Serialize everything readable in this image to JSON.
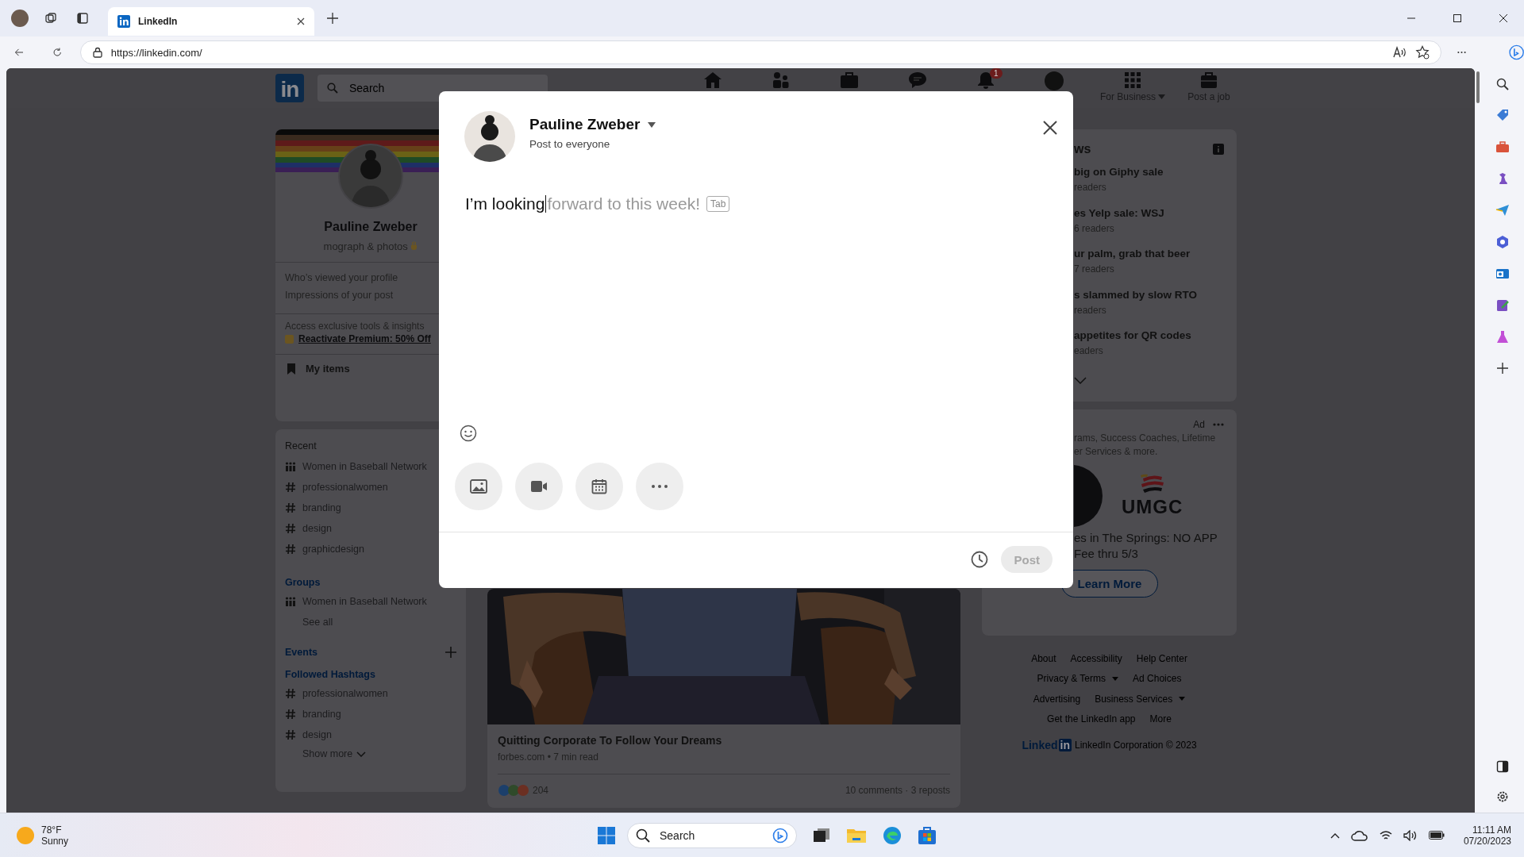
{
  "browser": {
    "tabs": [
      {
        "title": "LinkedIn",
        "selected": true
      }
    ],
    "url": "https://linkedin.com/"
  },
  "nav": {
    "logo": "in",
    "search_placeholder": "Search",
    "notification_count": "1",
    "labels": [
      "For Business",
      "Post a job"
    ]
  },
  "profile": {
    "name": "Pauline Zweber",
    "headline": "mograph & photos",
    "stats": [
      "Who’s viewed your profile",
      "Impressions of your post"
    ],
    "premium_note": "Access exclusive tools & insights",
    "premium_link": "Reactivate Premium: 50% Off",
    "my_items": "My items"
  },
  "recent": {
    "title": "Recent",
    "items": [
      {
        "kind": "group",
        "label": "Women in Baseball Network"
      },
      {
        "kind": "hashtag",
        "label": "professionalwomen"
      },
      {
        "kind": "hashtag",
        "label": "branding"
      },
      {
        "kind": "hashtag",
        "label": "design"
      },
      {
        "kind": "hashtag",
        "label": "graphicdesign"
      }
    ]
  },
  "groups": {
    "title": "Groups",
    "items": [
      {
        "kind": "group",
        "label": "Women in Baseball Network"
      }
    ],
    "see_all": "See all"
  },
  "events": {
    "title": "Events"
  },
  "hashtags": {
    "title": "Followed Hashtags",
    "items": [
      {
        "kind": "hashtag",
        "label": "professionalwomen"
      },
      {
        "kind": "hashtag",
        "label": "branding"
      },
      {
        "kind": "hashtag",
        "label": "design"
      }
    ],
    "show_more": "Show more"
  },
  "post": {
    "title": "Quitting Corporate To Follow Your Dreams",
    "meta": "forbes.com • 7 min read",
    "reactions": "204",
    "engagement": "10 comments · 3 reposts"
  },
  "news": {
    "heading": "ws",
    "items": [
      {
        "title": "big on Giphy sale",
        "readers": "readers"
      },
      {
        "title": "es Yelp sale: WSJ",
        "readers": "6 readers"
      },
      {
        "title": "ur palm, grab that beer",
        "readers": "7 readers"
      },
      {
        "title": "s slammed by slow RTO",
        "readers": "readers"
      },
      {
        "title": "appetites for QR codes",
        "readers": "eaders"
      }
    ]
  },
  "ad": {
    "label": "Ad",
    "text_lines": [
      "rams, Success Coaches, Lifetime",
      "er Services & more."
    ],
    "brand": "UMGC",
    "headline_lines": [
      "es in The Springs: NO APP",
      "Fee thru 5/3"
    ],
    "button": "Learn More"
  },
  "footer": {
    "rows": [
      [
        {
          "label": "About",
          "dropdown": false
        },
        {
          "label": "Accessibility",
          "dropdown": false
        },
        {
          "label": "Help Center",
          "dropdown": false
        }
      ],
      [
        {
          "label": "Privacy & Terms",
          "dropdown": true
        },
        {
          "label": "Ad Choices",
          "dropdown": false
        }
      ],
      [
        {
          "label": "Advertising",
          "dropdown": false
        },
        {
          "label": "Business Services",
          "dropdown": true
        }
      ],
      [
        {
          "label": "Get the LinkedIn app",
          "dropdown": false
        },
        {
          "label": "More",
          "dropdown": false
        }
      ]
    ],
    "logo_word": "Linked",
    "logo_box": "in",
    "copyright": "LinkedIn Corporation © 2023"
  },
  "composer": {
    "author": "Pauline Zweber",
    "audience": "Post to everyone",
    "text": "I’m looking",
    "suggestion": "forward to this week!",
    "key_hint": "Tab",
    "post_button": {
      "label": "Post",
      "disabled": true
    }
  },
  "taskbar": {
    "temperature": "78°F",
    "condition": "Sunny",
    "search_placeholder": "Search",
    "time": "11:11 AM",
    "date": "07/20/2023"
  }
}
